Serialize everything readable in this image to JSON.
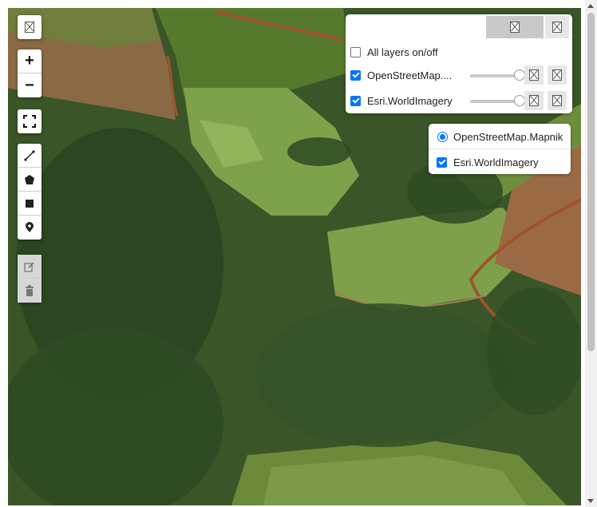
{
  "map": {
    "type": "satellite-imagery",
    "colors": {
      "forest": "#2f4a22",
      "field": "#7a9a45",
      "soil": "#9a5a3a",
      "road": "#a0522d"
    }
  },
  "toolbar": {
    "layers_toggle_icon": "image-placeholder-icon",
    "zoom_in_label": "+",
    "zoom_out_label": "−",
    "fullscreen_icon": "fullscreen-icon",
    "draw_tools": [
      "polyline-icon",
      "polygon-icon",
      "rectangle-icon",
      "marker-icon"
    ],
    "edit_tools": [
      "edit-icon",
      "trash-icon"
    ]
  },
  "layer_panel": {
    "all_layers_label": "All layers on/off",
    "all_layers_checked": false,
    "layers": [
      {
        "label": "OpenStreetMap....",
        "checked": true,
        "opacity": 1.0
      },
      {
        "label": "Esri.WorldImagery",
        "checked": true,
        "opacity": 1.0
      }
    ]
  },
  "legend": {
    "base_layer": {
      "label": "OpenStreetMap.Mapnik",
      "selected": true
    },
    "overlay": {
      "label": "Esri.WorldImagery",
      "checked": true
    }
  }
}
